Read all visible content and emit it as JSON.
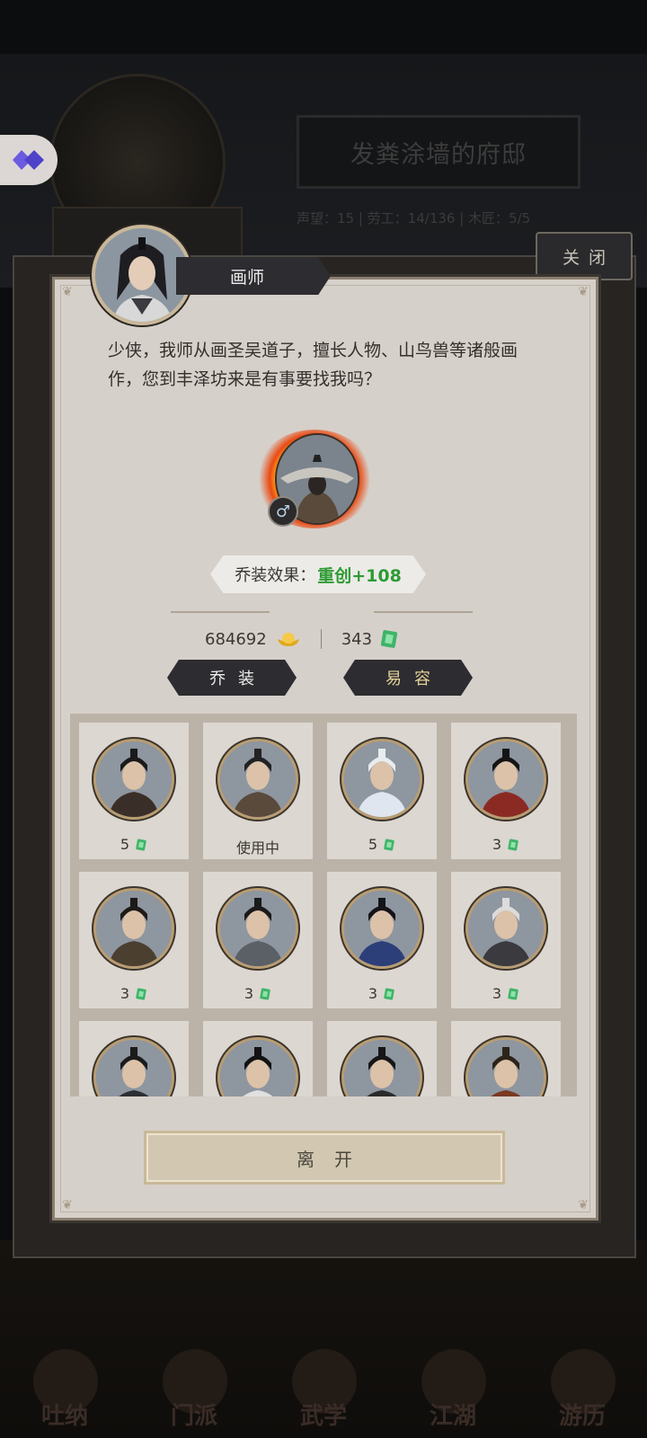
{
  "background": {
    "title": "发粪涂墙的府邸",
    "stats": "声望：15  |  劳工：14/136  |  木匠：5/5",
    "nav_items": [
      "吐纳",
      "门派",
      "武学",
      "江湖",
      "游历"
    ]
  },
  "close_button": {
    "label": "关闭"
  },
  "npc": {
    "name": "画师",
    "dialog": "少侠，我师从画圣吴道子，擅长人物、山鸟兽等诸般画作，您到丰泽坊来是有事要找我吗？"
  },
  "current_disguise": {
    "gender_symbol": "♂",
    "effect_label": "乔装效果：",
    "effect_value": "重创+108"
  },
  "currency": {
    "gold": "684692",
    "jade": "343"
  },
  "buttons": {
    "disguise": "乔装",
    "makeup": "易容",
    "leave": "离开"
  },
  "disguise_options": [
    {
      "price": "5",
      "in_use": false
    },
    {
      "status": "使用中",
      "in_use": true
    },
    {
      "price": "5",
      "in_use": false
    },
    {
      "price": "3",
      "in_use": false
    },
    {
      "price": "3",
      "in_use": false
    },
    {
      "price": "3",
      "in_use": false
    },
    {
      "price": "3",
      "in_use": false
    },
    {
      "price": "3",
      "in_use": false
    },
    {
      "price": "",
      "in_use": false
    },
    {
      "price": "",
      "in_use": false
    },
    {
      "price": "",
      "in_use": false
    },
    {
      "price": "",
      "in_use": false
    }
  ],
  "colors": {
    "accent_green": "#2e9b33",
    "panel": "#d6d0ca",
    "dark_plate": "#2d2c30"
  }
}
